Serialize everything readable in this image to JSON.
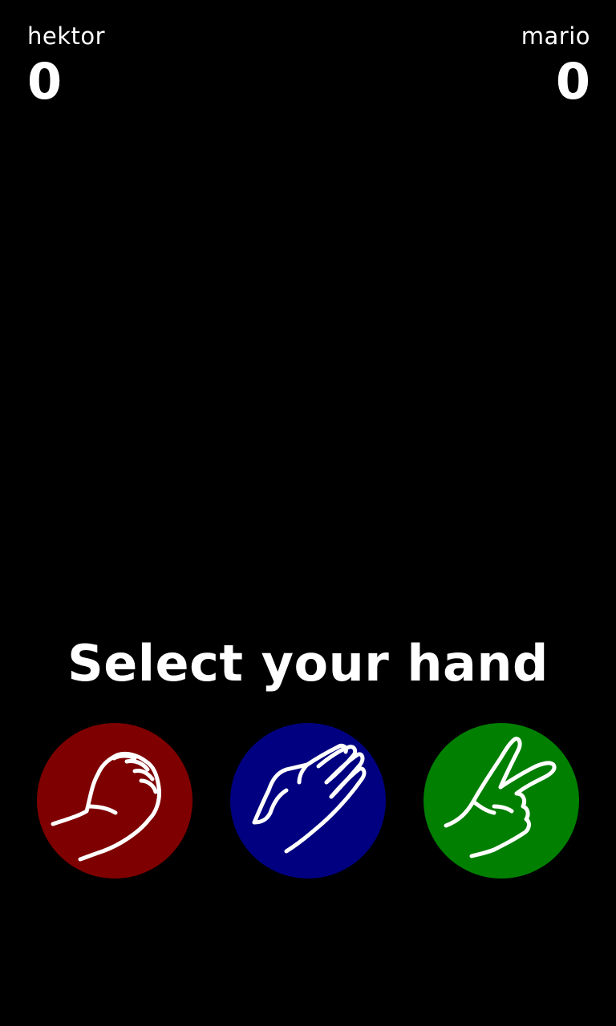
{
  "players": {
    "left": {
      "name": "hektor",
      "score": "0"
    },
    "right": {
      "name": "mario",
      "score": "0"
    }
  },
  "prompt": "Select your hand",
  "hands": [
    {
      "id": "rock",
      "icon": "rock-hand-icon",
      "color": "#7f0000"
    },
    {
      "id": "paper",
      "icon": "paper-hand-icon",
      "color": "#000080"
    },
    {
      "id": "scissors",
      "icon": "scissors-hand-icon",
      "color": "#007f00"
    }
  ]
}
